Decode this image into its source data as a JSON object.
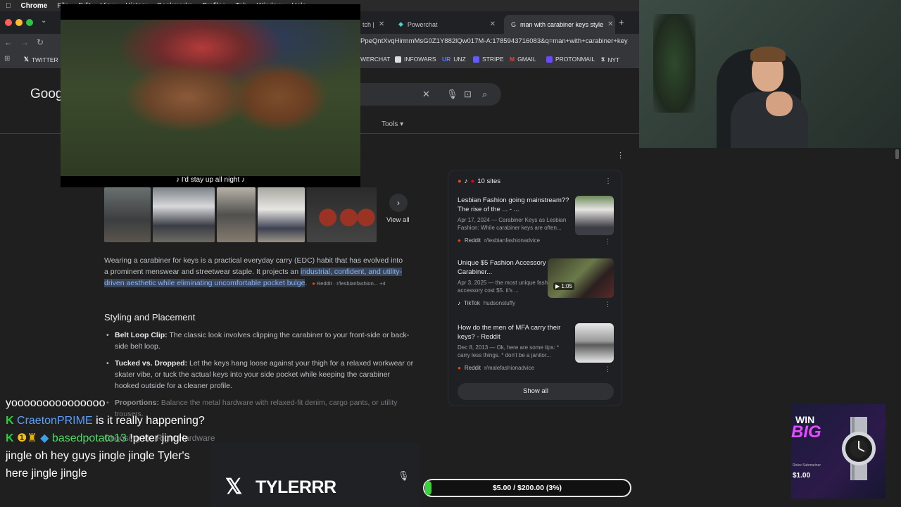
{
  "menubar": {
    "app": "Chrome",
    "items": [
      "File",
      "Edit",
      "View",
      "History",
      "Bookmarks",
      "Profiles",
      "Tab",
      "Window",
      "Help"
    ]
  },
  "tabs": [
    {
      "label": "tch |"
    },
    {
      "label": "Powerchat"
    },
    {
      "label": "man with carabiner keys style"
    }
  ],
  "address": {
    "url": "PpeQntXvqHirmmMsG0Z1Y882lQw017M-A:1785943716083&q=man+with+carabiner+key"
  },
  "bookmarks": [
    {
      "label": "TWITTER",
      "color": "#ffffff"
    },
    {
      "label": "WERCHAT",
      "color": "#00b3ff"
    },
    {
      "label": "INFOWARS",
      "color": "#dddddd"
    },
    {
      "label": "UNZ",
      "color": "#3b5bd6"
    },
    {
      "label": "STRIPE",
      "color": "#635bff"
    },
    {
      "label": "GMAIL",
      "color": "#ea4335"
    },
    {
      "label": "PROTONMAIL",
      "color": "#6d4aff"
    },
    {
      "label": "NYT",
      "color": "#ffffff"
    }
  ],
  "google": {
    "logo": "Goog",
    "tools": "Tools"
  },
  "video": {
    "caption": "♪ I'd stay up all night ♪"
  },
  "images": {
    "view_all": "View all"
  },
  "answer": {
    "intro": "Wearing a carabiner for keys is a practical everyday carry (EDC) habit that has evolved into a prominent menswear and streetwear staple. It projects an ",
    "highlight": "industrial, confident, and utility-driven aesthetic while eliminating uncomfortable pocket bulge",
    "tail": ".",
    "cite": "Reddit · r/lesbianfashion... +4"
  },
  "styling": {
    "heading": "Styling and Placement",
    "items": [
      {
        "term": "Belt Loop Clip:",
        "text": " The classic look involves clipping the carabiner to your front-side or back-side belt loop."
      },
      {
        "term": "Tucked vs. Dropped:",
        "text": " Let the keys hang loose against your thigh for a relaxed workwear or skater vibe, or tuck the actual keys into your side pocket while keeping the carabiner hooked outside for a cleaner profile."
      },
      {
        "term": "Proportions:",
        "text": " Balance the metal hardware with relaxed-fit denim, cargo pants, or utility trousers."
      }
    ],
    "next_heading": "Choosing the Right Hardware"
  },
  "sources": {
    "count": "10 sites",
    "items": [
      {
        "title": "Lesbian Fashion going mainstream?? The rise of the ... - ...",
        "snippet": "Apr 17, 2024 — Carabiner Keys as Lesbian Fashion: While carabiner keys are often...",
        "site": "Reddit",
        "path": "r/lesbianfashionadvice",
        "badge": ""
      },
      {
        "title": "Unique $5 Fashion Accessory - Carabiner...",
        "snippet": "Apr 3, 2025 — the most unique fashion accessory cost $5. it's ...",
        "site": "TikTok",
        "path": "hudsonstuffy",
        "badge": "▶ 1:05"
      },
      {
        "title": "How do the men of MFA carry their keys? - Reddit",
        "snippet": "Dec 8, 2013 — Ok, here are some tips: * carry less things. * don't be a janitor...",
        "site": "Reddit",
        "path": "r/malefashionadvice",
        "badge": ""
      }
    ],
    "show_all": "Show all"
  },
  "chat": {
    "lines": [
      {
        "user": "",
        "text": "yooooooooooooooo"
      },
      {
        "user": "CraetonPRIME",
        "text": "is it really happening?"
      },
      {
        "user": "basedpotato13",
        "text": "!peter jingle jingle oh hey guys jingle jingle Tyler's here jingle jingle"
      }
    ]
  },
  "stream": {
    "handle": "TYLERRR"
  },
  "donation": {
    "label": "$5.00 / $200.00 (3%)",
    "fraction": 0.03
  },
  "ad": {
    "win": "WIN",
    "big": "BIG",
    "model": "Rolex Submariner",
    "price": "$1.00"
  }
}
